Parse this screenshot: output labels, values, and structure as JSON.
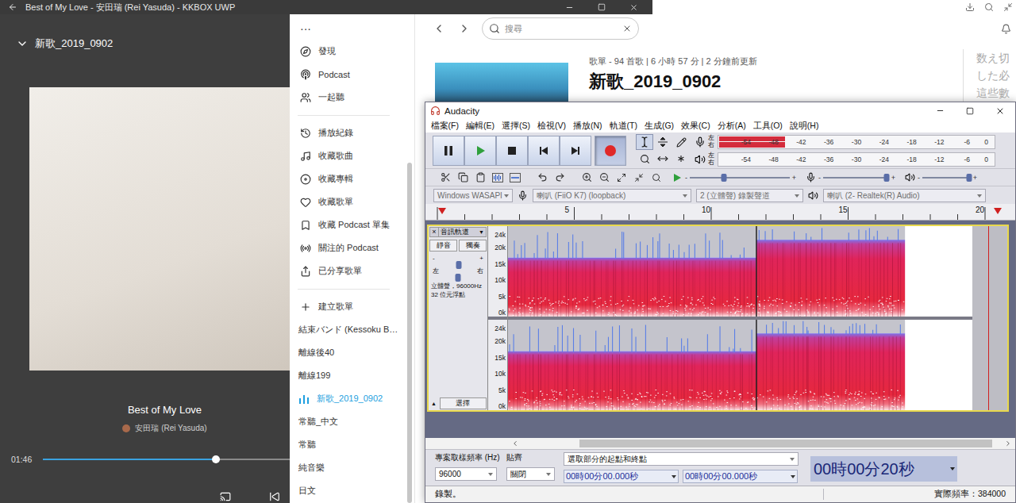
{
  "kkbox": {
    "window": {
      "title": "Best of My Love - 安田瑞 (Rei Yasuda) - KKBOX UWP"
    },
    "player": {
      "playlist": "新歌_2019_0902",
      "song": "Best of My Love",
      "artist": "安田瑞 (Rei Yasuda)",
      "time": "01:46",
      "level": 0.7
    },
    "sidebar": {
      "more": "···",
      "sections": [
        {
          "items": [
            {
              "label": "發現",
              "kind": "nav",
              "selected": false
            },
            {
              "label": "Podcast",
              "kind": "nav",
              "selected": false
            },
            {
              "label": "一起聽",
              "kind": "nav",
              "selected": false
            }
          ]
        },
        {
          "items": [
            {
              "label": "播放紀錄",
              "kind": "nav",
              "selected": false
            },
            {
              "label": "收藏歌曲",
              "kind": "nav",
              "selected": false
            },
            {
              "label": "收藏專輯",
              "kind": "nav",
              "selected": false
            },
            {
              "label": "收藏歌單",
              "kind": "nav",
              "selected": false
            },
            {
              "label": "收藏 Podcast 單集",
              "kind": "nav",
              "selected": false
            },
            {
              "label": "關注的 Podcast",
              "kind": "nav",
              "selected": false
            },
            {
              "label": "已分享歌單",
              "kind": "nav",
              "selected": false
            }
          ]
        },
        {
          "items": [
            {
              "label": "建立歌單",
              "kind": "create",
              "selected": false
            },
            {
              "label": "結束バンド (Kessoku B…",
              "kind": "playlist",
              "selected": false
            },
            {
              "label": "離線後40",
              "kind": "playlist",
              "selected": false
            },
            {
              "label": "離線199",
              "kind": "playlist",
              "selected": false
            },
            {
              "label": "新歌_2019_0902",
              "kind": "playlist",
              "selected": true
            },
            {
              "label": "常聽_中文",
              "kind": "playlist",
              "selected": false
            },
            {
              "label": "常聽",
              "kind": "playlist",
              "selected": false
            },
            {
              "label": "純音樂",
              "kind": "playlist",
              "selected": false
            },
            {
              "label": "日文",
              "kind": "playlist",
              "selected": false
            }
          ]
        }
      ]
    },
    "content": {
      "search": {
        "placeholder": "搜尋"
      },
      "playlist": {
        "meta": "歌單 - 94 首歌 | 6 小時 57 分 | 2 分鐘前更新",
        "title": "新歌_2019_0902"
      },
      "side_text": [
        "数え切",
        "した必",
        "這些數"
      ]
    }
  },
  "audacity": {
    "window": {
      "title": "Audacity"
    },
    "menu": [
      "檔案(F)",
      "編輯(E)",
      "選擇(S)",
      "檢視(V)",
      "播放(N)",
      "軌道(T)",
      "生成(G)",
      "效果(C)",
      "分析(A)",
      "工具(O)",
      "說明(H)"
    ],
    "transport": [
      {
        "kind": "pause",
        "pressed": false
      },
      {
        "kind": "play",
        "pressed": false
      },
      {
        "kind": "stop",
        "pressed": false
      },
      {
        "kind": "skip-start",
        "pressed": false
      },
      {
        "kind": "skip-end",
        "pressed": false
      },
      {
        "kind": "record",
        "pressed": true
      }
    ],
    "tools": [
      {
        "kind": "select",
        "selected": true
      },
      {
        "kind": "envelope",
        "selected": false
      },
      {
        "kind": "draw",
        "selected": false
      },
      {
        "kind": "zoom",
        "selected": false
      },
      {
        "kind": "time-shift",
        "selected": false
      },
      {
        "kind": "multi",
        "selected": false
      }
    ],
    "meters": [
      {
        "kind": "record",
        "channels": [
          "左",
          "右"
        ],
        "levels": [
          0.24,
          0.24
        ]
      },
      {
        "kind": "playback",
        "channels": [
          "左",
          "右"
        ],
        "levels": [
          0,
          0
        ]
      }
    ],
    "meter_ticks": [
      "-54",
      "-48",
      "-42",
      "-36",
      "-30",
      "-24",
      "-18",
      "-12",
      "-6",
      "0"
    ],
    "sliders": [
      {
        "kind": "speed",
        "min": "-",
        "max": "+",
        "level": 0.34
      },
      {
        "kind": "record-volume",
        "min": "-",
        "max": "+",
        "level": 0.97
      },
      {
        "kind": "playback-volume",
        "min": "-",
        "max": "+",
        "level": 0.97
      }
    ],
    "devices": [
      {
        "kind": "host",
        "value": "Windows WASAPI",
        "disabled": true
      },
      {
        "kind": "input",
        "value": "喇叭 (FiiO K7) (loopback)",
        "disabled": true
      },
      {
        "kind": "channels",
        "value": "2 (立體聲) 錄製聲道",
        "disabled": true
      },
      {
        "kind": "output",
        "value": "喇叭 (2- Realtek(R) Audio)",
        "disabled": true
      }
    ],
    "ruler": {
      "ticks": [
        "5",
        "10",
        "15",
        "20"
      ]
    },
    "track": {
      "close": "×",
      "name": "音訊軌道",
      "menu": "▼",
      "mute": "靜音",
      "solo": "獨奏",
      "gain": {
        "min": "-",
        "max": "+",
        "level": 0.52
      },
      "pan": {
        "min": "左",
        "max": "右",
        "level": 0.5
      },
      "info": [
        "立體聲，96000Hz",
        "32 位元浮點"
      ],
      "collapse": "▲",
      "select": "選擇",
      "selected": true,
      "channel_count": 2,
      "axis": [
        "24k",
        "20k",
        "15k",
        "10k",
        "5k",
        "0k"
      ],
      "segments": [
        {
          "start": 0,
          "end": 0.535,
          "top_khz": 17
        },
        {
          "start": 0.535,
          "end": 0.855,
          "top_khz": 22.5
        }
      ]
    },
    "scrollbar": {
      "offset": 0.12,
      "level": 0.86
    },
    "selection_bar": {
      "rate_label": "專案取樣頻率 (Hz)",
      "rate": "96000",
      "snap_label": "貼齊",
      "snap": "關閉",
      "mode": "選取部分的起點和終點",
      "start": "00時00分00.000秒",
      "end": "00時00分00.000秒",
      "timer": "00時00分20秒"
    },
    "status_bar": {
      "state": "錄製。",
      "rate": "實際頻率：384000"
    }
  }
}
